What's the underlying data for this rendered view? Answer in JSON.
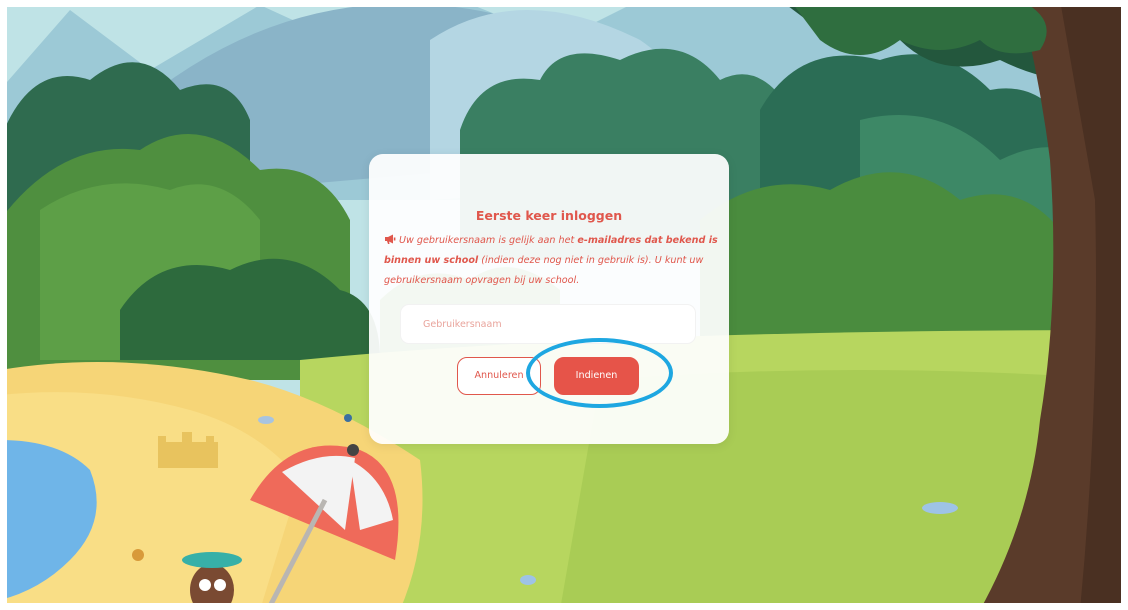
{
  "modal": {
    "title": "Eerste keer inloggen",
    "message_part1": "Uw gebruikersnaam is gelijk aan het ",
    "message_bold": "e-mailadres dat bekend is binnen uw school",
    "message_part2": " (indien deze nog niet in gebruik is). U kunt uw gebruikersnaam opvragen bij uw school.",
    "username_placeholder": "Gebruikersnaam",
    "username_value": "",
    "cancel_label": "Annuleren",
    "submit_label": "Indienen"
  },
  "icons": {
    "message_icon": "megaphone-icon"
  },
  "colors": {
    "accent": "#e0574c",
    "submit_bg": "#e65449",
    "highlight_ring": "#1ea7e1"
  }
}
